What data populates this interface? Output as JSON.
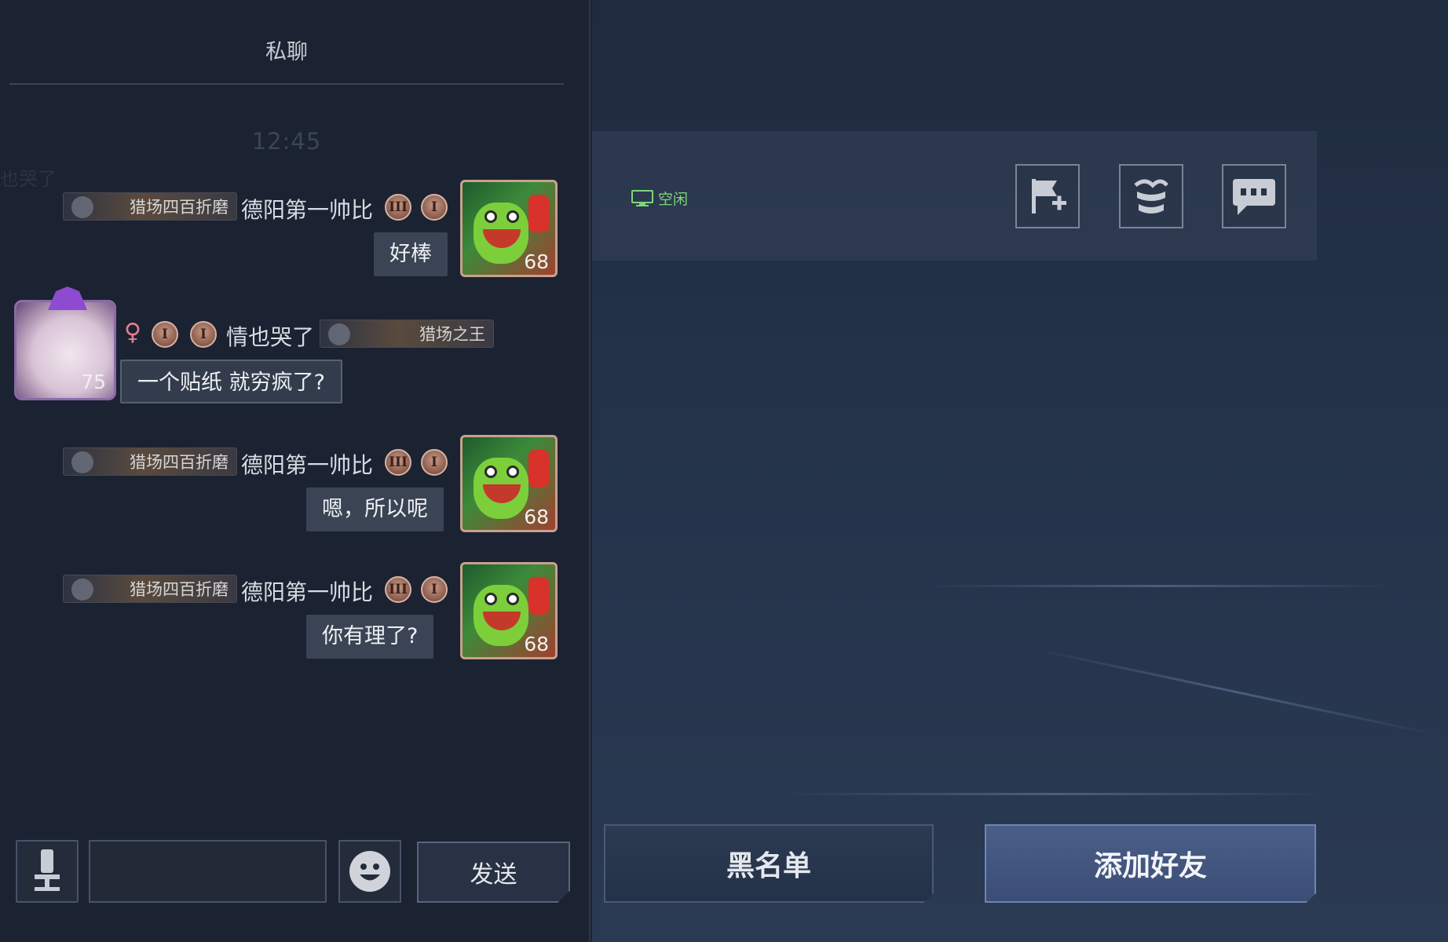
{
  "chat": {
    "title": "私聊",
    "timestamp": "12:45",
    "ghost_text": "也哭了",
    "messages": [
      {
        "sender": "德阳第一帅比",
        "title_badge": "猎场四百折磨",
        "rank_badges": [
          "III",
          "I"
        ],
        "text": "好棒",
        "avatar_level": "68",
        "side": "right"
      },
      {
        "sender": "情也哭了",
        "title_badge": "猎场之王",
        "gender": "♀",
        "rank_badges": [
          "I",
          "I"
        ],
        "text": "一个贴纸 就穷疯了?",
        "avatar_level": "75",
        "side": "left"
      },
      {
        "sender": "德阳第一帅比",
        "title_badge": "猎场四百折磨",
        "rank_badges": [
          "III",
          "I"
        ],
        "text": "嗯，所以呢",
        "avatar_level": "68",
        "side": "right"
      },
      {
        "sender": "德阳第一帅比",
        "title_badge": "猎场四百折磨",
        "rank_badges": [
          "III",
          "I"
        ],
        "text": "你有理了?",
        "avatar_level": "68",
        "side": "right"
      }
    ],
    "input": {
      "value": "",
      "placeholder": ""
    },
    "send_label": "发送"
  },
  "profile": {
    "status": "空闲",
    "status_color": "#7ed67a",
    "action_icons": [
      "flag-plus-icon",
      "gift-icon",
      "chat-bubble-icon"
    ]
  },
  "buttons": {
    "blacklist": "黑名单",
    "add_friend": "添加好友"
  },
  "colors": {
    "panel_bg": "#1b2232",
    "bubble_bg": "#3a4454",
    "accent_button": "#4a5e88"
  }
}
